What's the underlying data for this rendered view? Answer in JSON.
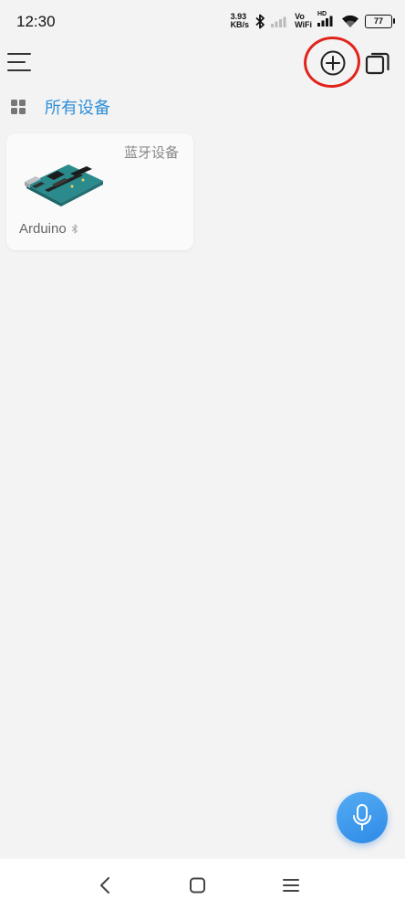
{
  "status_bar": {
    "time": "12:30",
    "net_speed_value": "3.93",
    "net_speed_unit": "KB/s",
    "vowifi_top": "Vo",
    "vowifi_bottom": "WiFi",
    "hd_label": "HD",
    "battery": "77"
  },
  "header": {
    "menu_icon": "hamburger-menu-icon",
    "add_icon": "add-circle-icon",
    "multi_icon": "multi-window-icon"
  },
  "group": {
    "title": "所有设备",
    "icon": "grid-icon"
  },
  "devices": [
    {
      "type_label": "蓝牙设备",
      "name": "Arduino",
      "connection_icon": "bluetooth-icon",
      "image": "arduino-board-image"
    }
  ],
  "fab": {
    "icon": "microphone-icon"
  },
  "colors": {
    "accent": "#2f8fd8",
    "highlight_ring": "#e0241c",
    "fab": "#3d98ee",
    "background": "#f3f3f3"
  }
}
